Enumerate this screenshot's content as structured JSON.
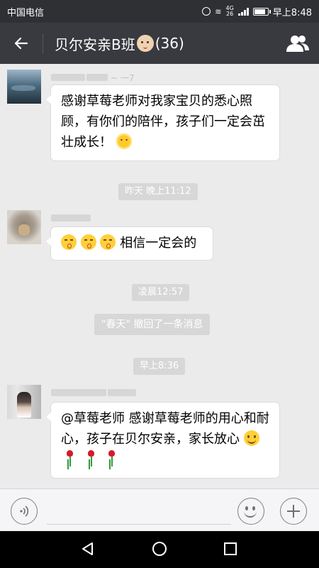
{
  "status_bar": {
    "carrier": "中国电信",
    "network_badge": "4G",
    "network_badge_2": "26",
    "battery_percent": 85,
    "time": "早上8:48"
  },
  "header": {
    "title": "贝尔安亲B班",
    "member_count": "(36)",
    "back_icon": "arrow-left-icon",
    "group_icon": "group-members-icon"
  },
  "messages": [
    {
      "sender_suffix": "~ 一7",
      "text_before": "感谢草莓老师对我家宝贝的悉心照顾，有你们的陪伴，孩子们一定会茁壮成长！",
      "emoji": "sun-emoji"
    },
    {
      "text_after": "相信一定会的",
      "emoji": "kiss-emoji"
    },
    {
      "text_before": "@草莓老师 感谢草莓老师的用心和耐心，孩子在贝尔安亲，家长放心",
      "emoji": "smile-emoji",
      "extra_emoji": "rose-emoji"
    }
  ],
  "timestamps": {
    "t1": "昨天 晚上11:12",
    "t2": "凌晨12:57",
    "t3": "早上8:36"
  },
  "system_notice": "\"春天\" 撤回了一条消息",
  "input_bar": {
    "voice_icon": "voice-icon",
    "emoji_icon": "emoji-face-icon",
    "plus_icon": "plus-icon"
  },
  "nav_bar": {
    "back_icon": "triangle-back-icon",
    "home_icon": "circle-home-icon",
    "recent_icon": "square-recent-icon"
  },
  "colors": {
    "header": "#393a3f",
    "status_bar": "#2e3033",
    "background": "#ebebeb",
    "bubble": "#ffffff",
    "pill": "#d7d7d7"
  }
}
